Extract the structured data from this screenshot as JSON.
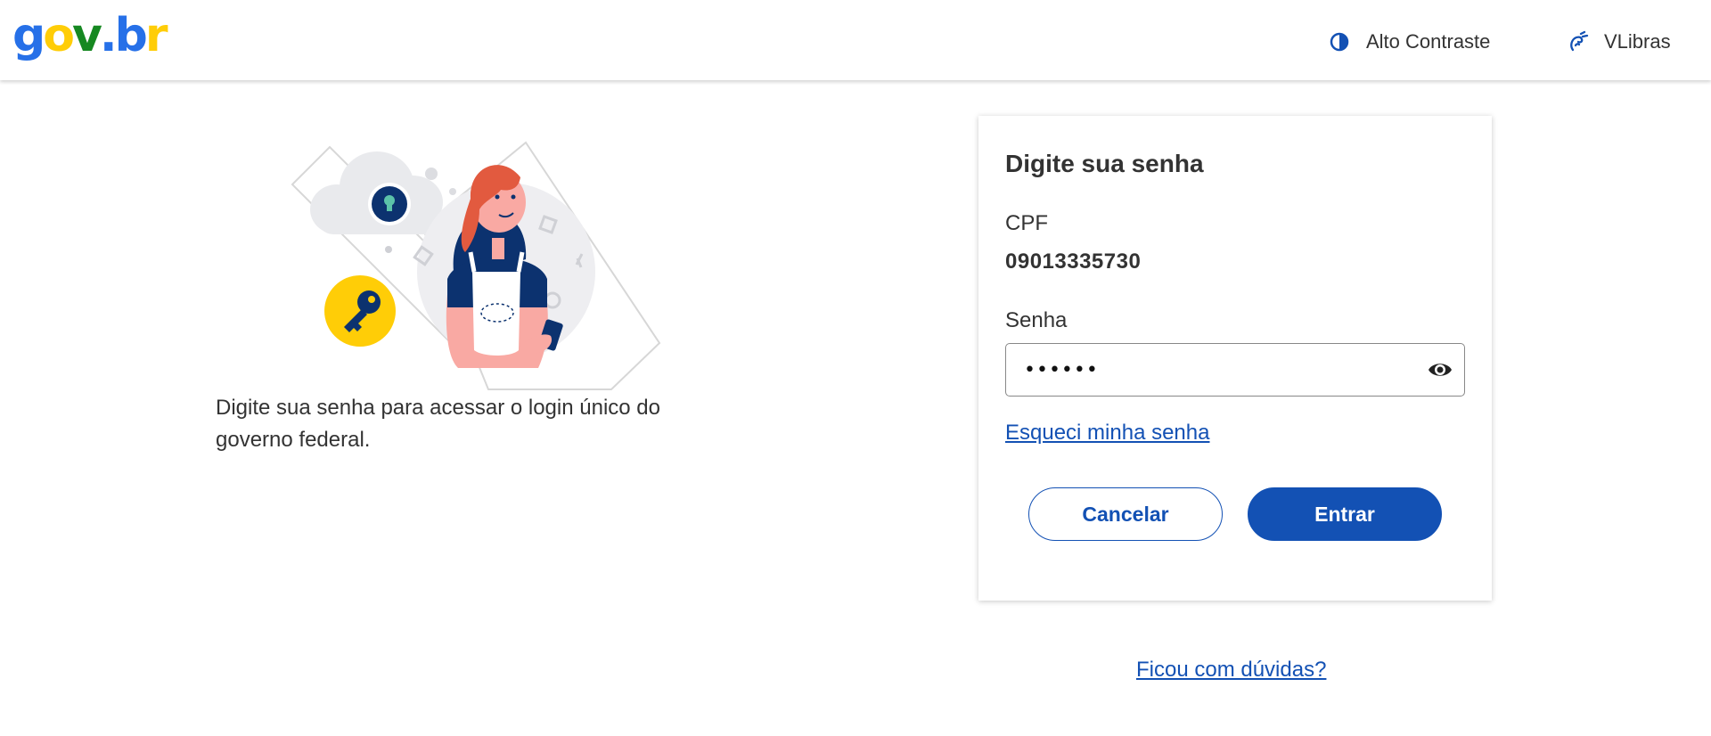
{
  "header": {
    "logo": {
      "parts": [
        "g",
        "o",
        "v",
        ".",
        "b",
        "r"
      ]
    },
    "contrast_label": "Alto Contraste",
    "vlibras_label": "VLibras"
  },
  "intro": {
    "text": "Digite sua senha para acessar o login único do governo federal."
  },
  "card": {
    "title": "Digite sua senha",
    "cpf_label": "CPF",
    "cpf_value": "09013335730",
    "password_label": "Senha",
    "password_value": "••••••",
    "forgot_link": "Esqueci minha senha",
    "cancel_label": "Cancelar",
    "enter_label": "Entrar"
  },
  "help_link": "Ficou com dúvidas?",
  "icons": {
    "contrast": "contrast-icon",
    "vlibras": "vlibras-hands-icon",
    "show_password": "eye-icon"
  },
  "colors": {
    "primary_blue": "#1351b4",
    "logo_blue": "#2670e8",
    "logo_green": "#168821",
    "logo_yellow": "#ffcd07",
    "text": "#333333"
  }
}
